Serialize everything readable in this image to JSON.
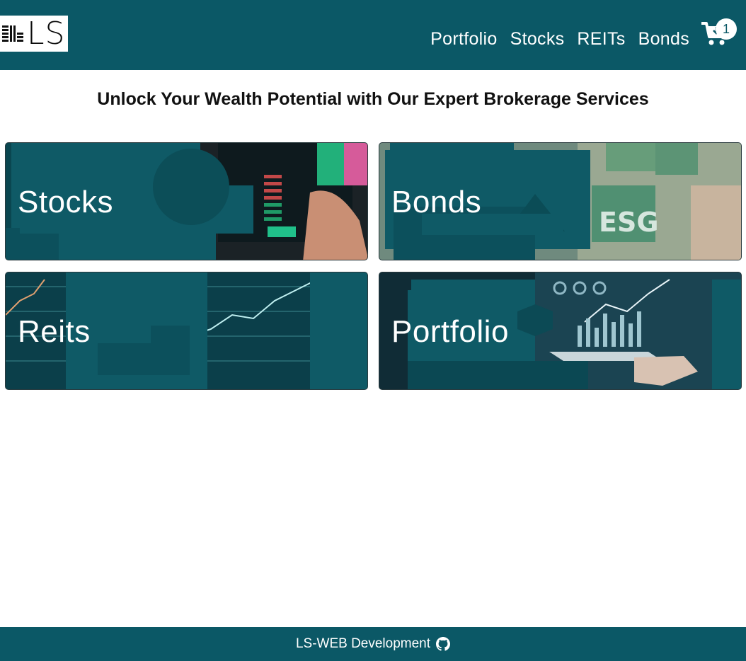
{
  "brand": {
    "logo_text": "LS"
  },
  "nav": {
    "items": [
      "Portfolio",
      "Stocks",
      "REITs",
      "Bonds"
    ]
  },
  "cart": {
    "icon": "cart-icon",
    "count": "1"
  },
  "headline": "Unlock Your Wealth Potential with Our Expert Brokerage Services",
  "cards": [
    {
      "label": "Stocks",
      "icon": "trading-tablet-image"
    },
    {
      "label": "Bonds",
      "icon": "esg-bonds-image"
    },
    {
      "label": "Reits",
      "icon": "market-chart-image"
    },
    {
      "label": "Portfolio",
      "icon": "portfolio-growth-image"
    }
  ],
  "footer": {
    "text": "LS-WEB Development",
    "icon": "github-icon"
  },
  "colors": {
    "primary": "#0b5866",
    "overlay": "#0f5a66",
    "background": "#ffffff",
    "text_dark": "#111111",
    "text_light": "#ffffff"
  }
}
